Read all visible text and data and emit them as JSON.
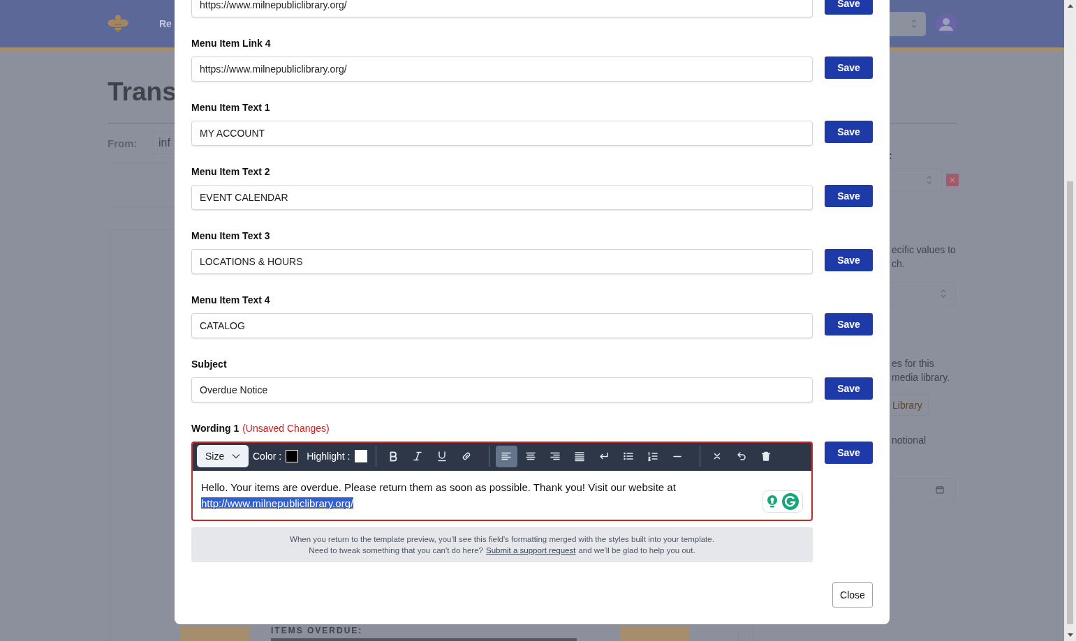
{
  "header": {
    "nav_fragment": "Re"
  },
  "page": {
    "title": "Trans",
    "from_label": "From:",
    "from_value": "inf",
    "preview_heading": "ITEMS OVERDUE:"
  },
  "side_panel": {
    "label_fragment": ":",
    "text_1": [
      "ecific values to",
      "ch."
    ],
    "text_2": [
      "es for this",
      "media library."
    ],
    "library_button": "Library",
    "text_3": "notional"
  },
  "modal": {
    "fields": [
      {
        "value": "https://www.milnepubliclibrary.org/",
        "action": "Save"
      },
      {
        "label": "Menu Item Link 4",
        "value": "https://www.milnepubliclibrary.org/",
        "action": "Save"
      },
      {
        "label": "Menu Item Text 1",
        "value": "MY ACCOUNT",
        "action": "Save"
      },
      {
        "label": "Menu Item Text 2",
        "value": "EVENT CALENDAR",
        "action": "Save"
      },
      {
        "label": "Menu Item Text 3",
        "value": "LOCATIONS & HOURS",
        "action": "Save"
      },
      {
        "label": "Menu Item Text 4",
        "value": "CATALOG",
        "action": "Save"
      },
      {
        "label": "Subject",
        "value": "Overdue Notice",
        "action": "Save"
      }
    ],
    "editor": {
      "label": "Wording 1",
      "unsaved": true,
      "status": "(Unsaved Changes)",
      "size_select": "Size",
      "color_label": "Color :",
      "highlight_label": "Highlight :",
      "tool_groups": [
        [
          {
            "kind": "bold",
            "selected": false
          },
          {
            "kind": "italic",
            "selected": false
          },
          {
            "kind": "underline",
            "selected": false
          },
          {
            "kind": "link",
            "selected": false
          }
        ],
        [
          {
            "kind": "align-left",
            "selected": true
          },
          {
            "kind": "align-center",
            "selected": false
          },
          {
            "kind": "align-right",
            "selected": false
          },
          {
            "kind": "justify",
            "selected": false
          },
          {
            "kind": "line-break",
            "selected": false
          },
          {
            "kind": "bullet-list",
            "selected": false
          },
          {
            "kind": "numbered-list",
            "selected": false
          },
          {
            "kind": "horizontal-rule",
            "selected": false
          }
        ],
        [
          {
            "kind": "clear",
            "selected": false
          },
          {
            "kind": "undo",
            "selected": false
          },
          {
            "kind": "delete",
            "selected": false
          }
        ]
      ],
      "content": "Hello. Your items are overdue. Please return them as soon as possible. Thank you! Visit our website at",
      "link": {
        "text": "http://www.milnepubliclibrary.org/",
        "selected": true
      },
      "action": "Save"
    },
    "note": {
      "line_1": "When you return to the template preview, you'll see this field's formatting merged with the styles built into your template.",
      "line_2_before": "Need to tweak something that you can't do here?",
      "line_2_link": "Submit a support request",
      "line_2_after": "and we'll be glad to help you out."
    },
    "close_button": "Close"
  }
}
